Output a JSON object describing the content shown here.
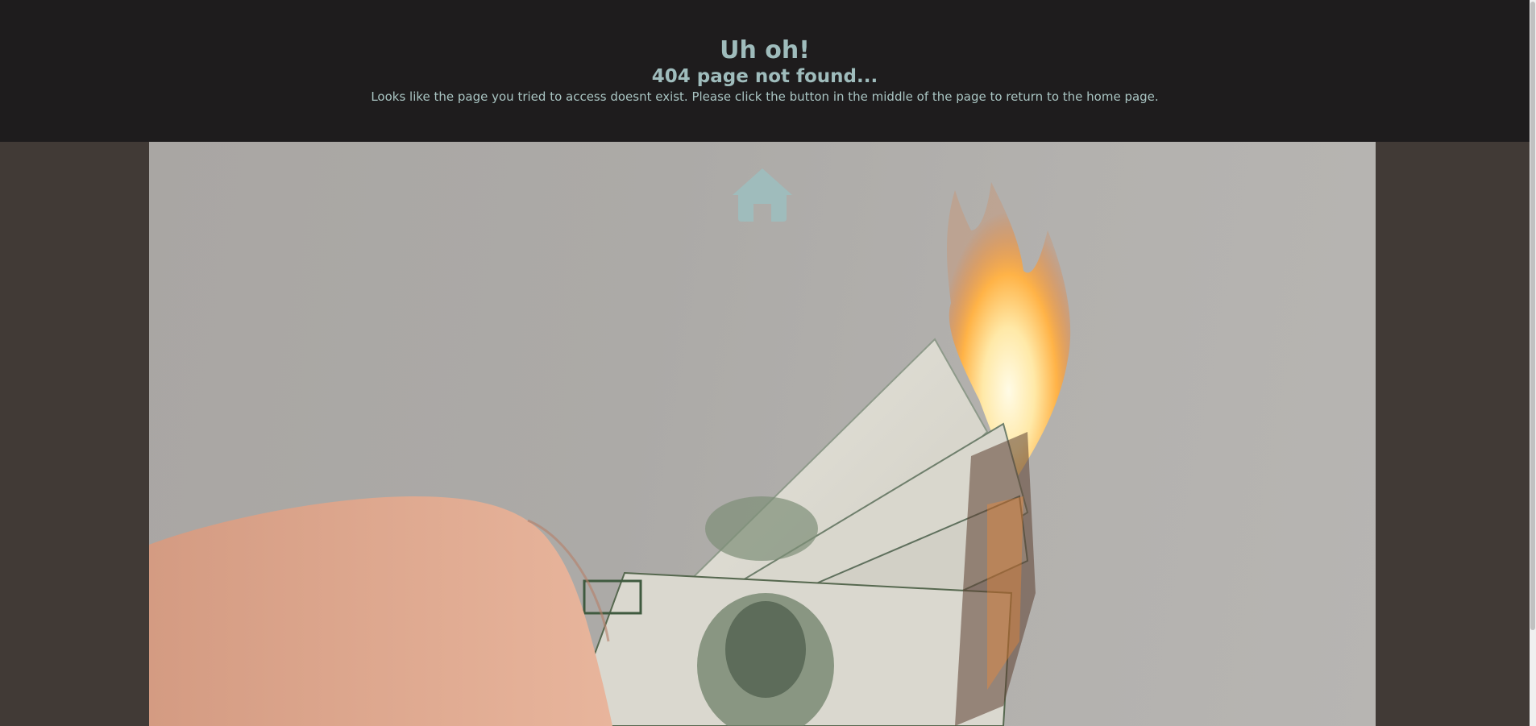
{
  "header": {
    "title": "Uh oh!",
    "subtitle": "404 page not found...",
    "message": "Looks like the page you tried to access doesnt exist. Please click the button in the middle of the page to return to the home page."
  },
  "hero": {
    "home_button_icon": "home-icon",
    "image_subject": "hand-holding-burning-dollar-bills"
  },
  "colors": {
    "header_bg": "#1e1c1d",
    "page_bg": "#413a36",
    "accent": "#9fbcbc"
  }
}
